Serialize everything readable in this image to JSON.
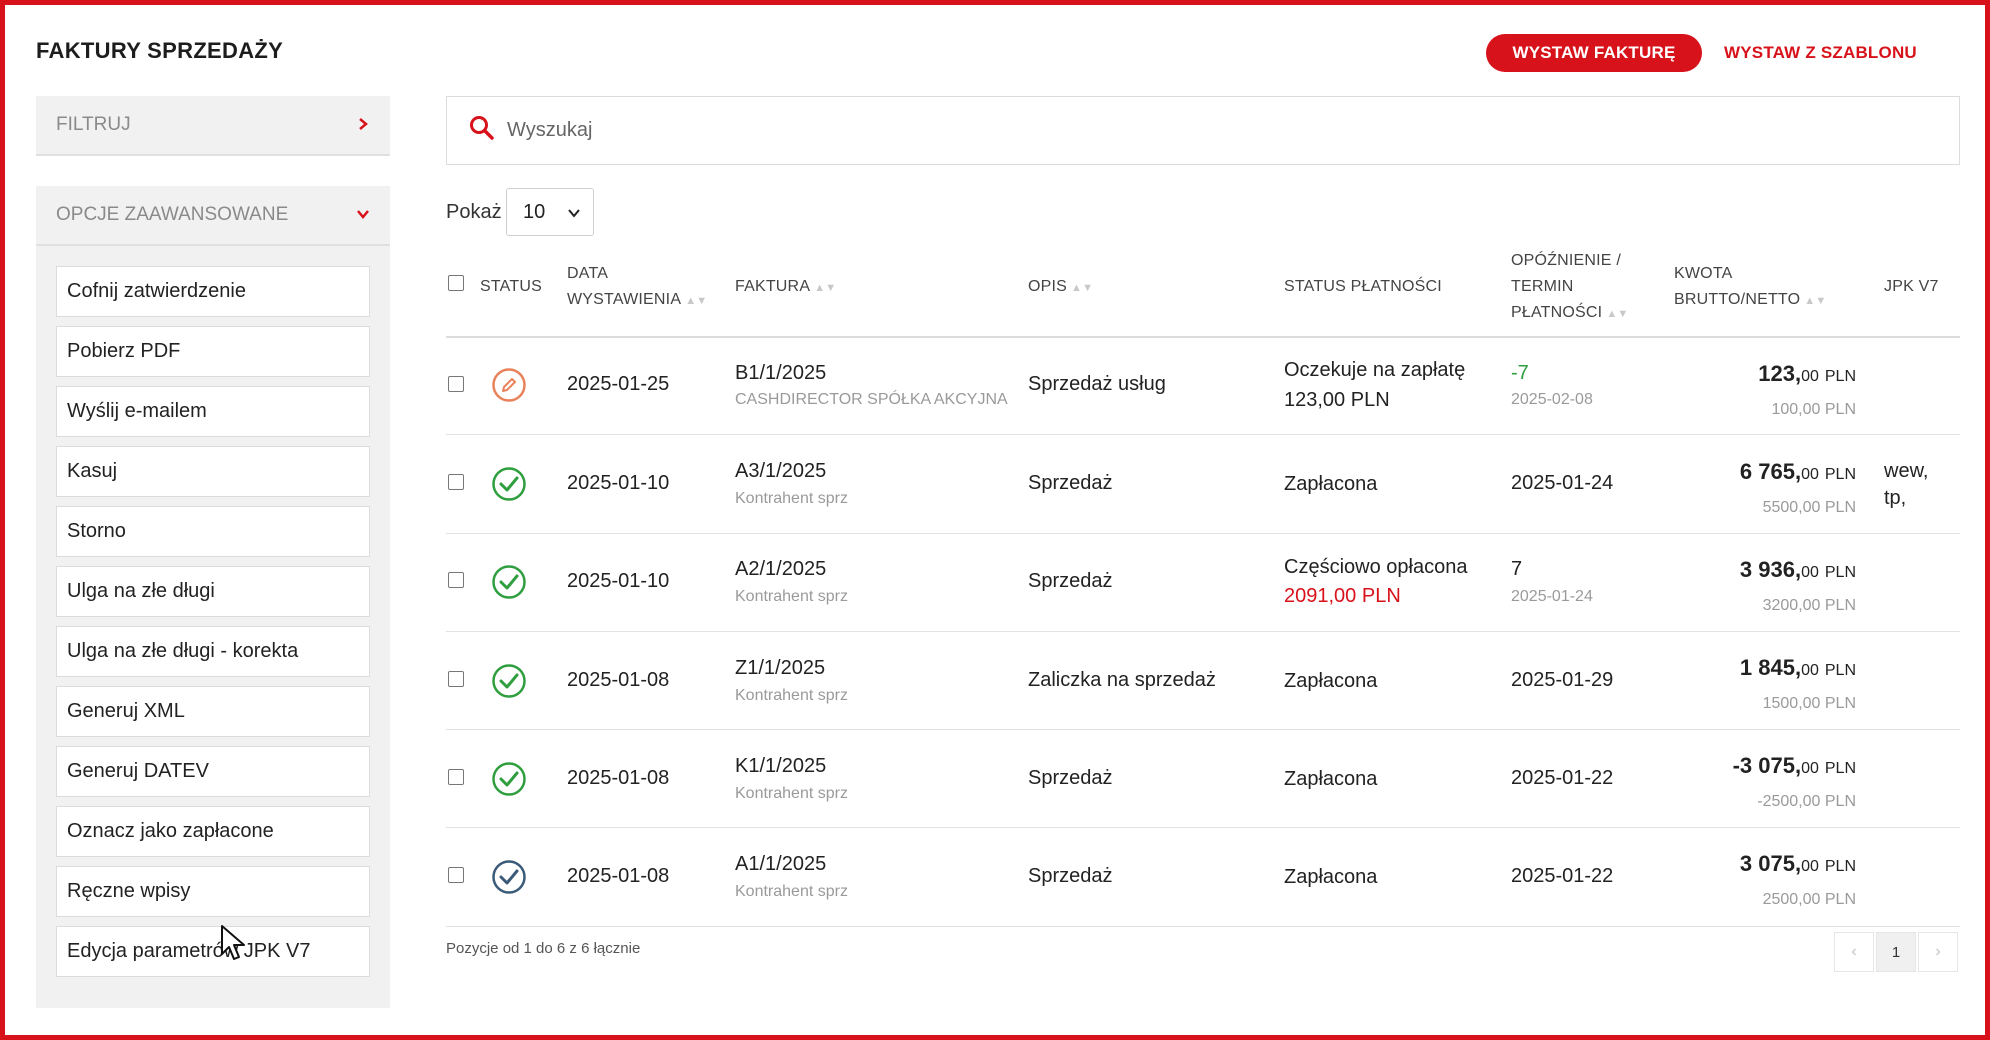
{
  "header": {
    "title": "FAKTURY SPRZEDAŻY",
    "primary_button": "WYSTAW FAKTURĘ",
    "secondary_button": "WYSTAW Z SZABLONU"
  },
  "sidebar": {
    "filter_label": "FILTRUJ",
    "advanced_label": "OPCJE ZAAWANSOWANE",
    "actions": [
      "Cofnij zatwierdzenie",
      "Pobierz PDF",
      "Wyślij e-mailem",
      "Kasuj",
      "Storno",
      "Ulga na złe długi",
      "Ulga na złe długi - korekta",
      "Generuj XML",
      "Generuj DATEV",
      "Oznacz jako zapłacone",
      "Ręczne wpisy",
      "Edycja parametrów JPK V7"
    ]
  },
  "search": {
    "placeholder": "Wyszukaj"
  },
  "page_size": {
    "label": "Pokaż",
    "value": "10"
  },
  "table": {
    "headers": {
      "status": "STATUS",
      "date_1": "DATA",
      "date_2": "WYSTAWIENIA",
      "invoice": "FAKTURA",
      "desc": "OPIS",
      "payment_status": "STATUS PŁATNOŚCI",
      "delay_1": "OPÓŹNIENIE /",
      "delay_2": "TERMIN",
      "delay_3": "PŁATNOŚCI",
      "amount_1": "KWOTA",
      "amount_2": "BRUTTO/NETTO",
      "jpk": "JPK V7"
    },
    "rows": [
      {
        "status_icon": "pencil-icon",
        "date": "2025-01-25",
        "invoice": "B1/1/2025",
        "client": "CASHDIRECTOR SPÓŁKA AKCYJNA",
        "desc": "Sprzedaż usług",
        "payment": "Oczekuje na zapłatę",
        "payment_sub": "123,00 PLN",
        "delay": "-7",
        "due": "2025-02-08",
        "gross_int": "123,",
        "gross_dec": "00",
        "currency": "PLN",
        "net": "100,00 PLN",
        "jpk": ""
      },
      {
        "status_icon": "check-circle-icon",
        "date": "2025-01-10",
        "invoice": "A3/1/2025",
        "client": "Kontrahent sprz",
        "desc": "Sprzedaż",
        "payment": "Zapłacona",
        "payment_sub": "",
        "delay": "2025-01-24",
        "due": "",
        "gross_int": "6 765,",
        "gross_dec": "00",
        "currency": "PLN",
        "net": "5500,00 PLN",
        "jpk": "wew,",
        "jpk2": "tp,"
      },
      {
        "status_icon": "check-circle-icon",
        "date": "2025-01-10",
        "invoice": "A2/1/2025",
        "client": "Kontrahent sprz",
        "desc": "Sprzedaż",
        "payment": "Częściowo opłacona",
        "payment_sub": "2091,00 PLN",
        "delay": "7",
        "due": "2025-01-24",
        "gross_int": "3 936,",
        "gross_dec": "00",
        "currency": "PLN",
        "net": "3200,00 PLN",
        "jpk": ""
      },
      {
        "status_icon": "check-circle-icon",
        "date": "2025-01-08",
        "invoice": "Z1/1/2025",
        "client": "Kontrahent sprz",
        "desc": "Zaliczka na sprzedaż",
        "payment": "Zapłacona",
        "payment_sub": "",
        "delay": "2025-01-29",
        "due": "",
        "gross_int": "1 845,",
        "gross_dec": "00",
        "currency": "PLN",
        "net": "1500,00 PLN",
        "jpk": ""
      },
      {
        "status_icon": "check-circle-icon",
        "date": "2025-01-08",
        "invoice": "K1/1/2025",
        "client": "Kontrahent sprz",
        "desc": "Sprzedaż",
        "payment": "Zapłacona",
        "payment_sub": "",
        "delay": "2025-01-22",
        "due": "",
        "gross_int": "-3 075,",
        "gross_dec": "00",
        "currency": "PLN",
        "net": "-2500,00 PLN",
        "jpk": ""
      },
      {
        "status_icon": "check-circle-dark-icon",
        "date": "2025-01-08",
        "invoice": "A1/1/2025",
        "client": "Kontrahent sprz",
        "desc": "Sprzedaż",
        "payment": "Zapłacona",
        "payment_sub": "",
        "delay": "2025-01-22",
        "due": "",
        "gross_int": "3 075,",
        "gross_dec": "00",
        "currency": "PLN",
        "net": "2500,00 PLN",
        "jpk": ""
      }
    ]
  },
  "footer": {
    "info": "Pozycje od 1 do 6 z 6 łącznie",
    "prev": "‹",
    "page": "1",
    "next": "›"
  },
  "colors": {
    "accent": "#d8121a",
    "check_green": "#2e9e3e",
    "pencil_orange": "#e8825a",
    "check_dark": "#3a5a78",
    "positive_delay": "#2e9e3e",
    "partial_red": "#d8121a"
  }
}
